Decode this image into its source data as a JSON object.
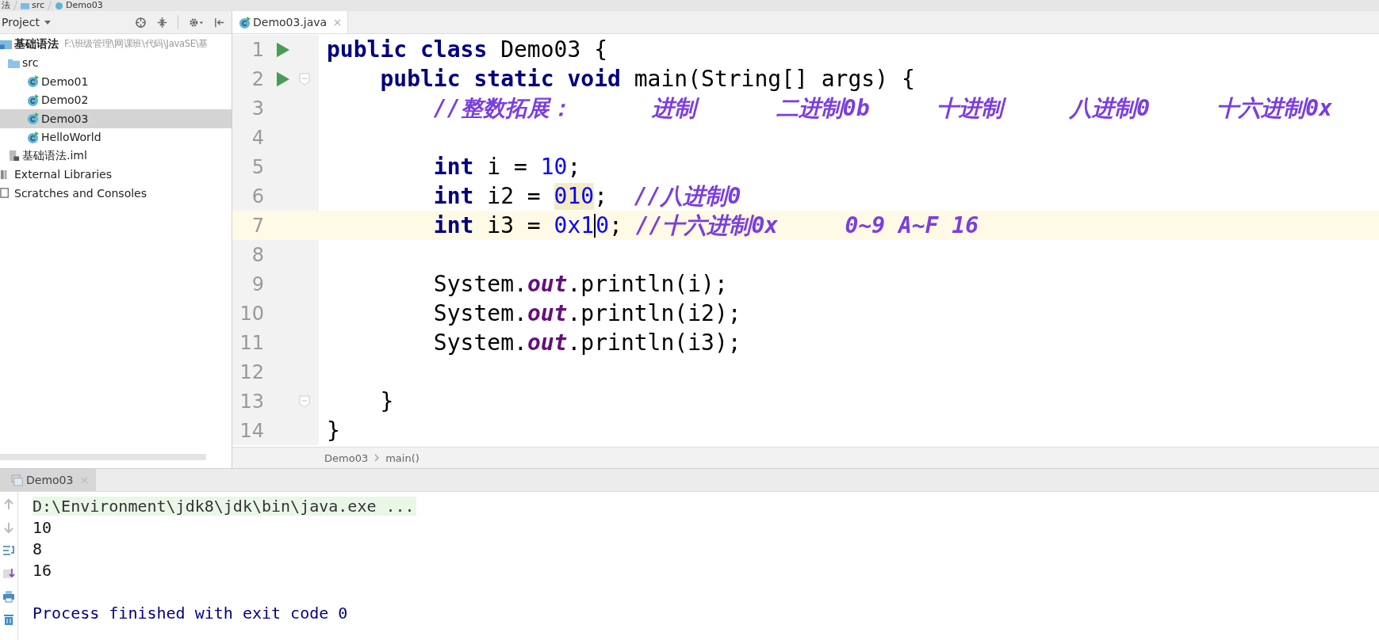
{
  "nav_bar": [
    {
      "label": "法",
      "kind": "module"
    },
    {
      "label": "src",
      "kind": "folder"
    },
    {
      "label": "Demo03",
      "kind": "class"
    }
  ],
  "project_panel": {
    "title": "Project",
    "tree": [
      {
        "label": "基础语法",
        "path": "F:\\班级管理\\网课班\\代码\\JavaSE\\基",
        "kind": "module",
        "selected": false,
        "children": [
          {
            "label": "src",
            "kind": "folder",
            "selected": false,
            "children": [
              {
                "label": "Demo01",
                "kind": "class",
                "selected": false
              },
              {
                "label": "Demo02",
                "kind": "class",
                "selected": false
              },
              {
                "label": "Demo03",
                "kind": "class",
                "selected": true
              },
              {
                "label": "HelloWorld",
                "kind": "class",
                "selected": false
              }
            ]
          },
          {
            "label": "基础语法.iml",
            "kind": "file",
            "selected": false
          }
        ]
      },
      {
        "label": "External Libraries",
        "kind": "library",
        "selected": false
      },
      {
        "label": "Scratches and Consoles",
        "kind": "scratches",
        "selected": false
      }
    ]
  },
  "editor": {
    "tabs": [
      {
        "label": "Demo03.java",
        "selected": true
      }
    ],
    "lines": [
      {
        "number": "1",
        "run": true,
        "tokens": [
          {
            "kind": "keyword",
            "text": "public class"
          },
          {
            "kind": "plain",
            "text": " Demo03 {"
          }
        ]
      },
      {
        "number": "2",
        "run": true,
        "fold": true,
        "tokens": [
          {
            "kind": "keyword",
            "text": "    public static void"
          },
          {
            "kind": "plain",
            "text": " main(String[] args) {"
          }
        ]
      },
      {
        "number": "3",
        "tokens": [
          {
            "kind": "comment",
            "text": "        //整数拓展：      进制      二进制0b     十进制     八进制0     十六进制0x"
          }
        ]
      },
      {
        "number": "4"
      },
      {
        "number": "5",
        "tokens": [
          {
            "kind": "keyword",
            "text": "        int"
          },
          {
            "kind": "plain",
            "text": " i = "
          },
          {
            "kind": "number",
            "text": "10"
          },
          {
            "kind": "plain",
            "text": ";"
          }
        ]
      },
      {
        "number": "6",
        "tokens": [
          {
            "kind": "keyword",
            "text": "        int"
          },
          {
            "kind": "plain",
            "text": " i2 = "
          },
          {
            "kind": "match",
            "text": "010"
          },
          {
            "kind": "plain",
            "text": ";  "
          },
          {
            "kind": "comment",
            "text": "//八进制0"
          }
        ]
      },
      {
        "number": "7",
        "current": true,
        "tokens": [
          {
            "kind": "keyword",
            "text": "        int"
          },
          {
            "kind": "plain",
            "text": " i3 = "
          },
          {
            "kind": "number",
            "text": "0x1"
          },
          {
            "kind": "caret"
          },
          {
            "kind": "number",
            "text": "0"
          },
          {
            "kind": "plain",
            "text": "; "
          },
          {
            "kind": "comment",
            "text": "//十六进制0x     0~9 A~F 16"
          }
        ]
      },
      {
        "number": "8"
      },
      {
        "number": "9",
        "tokens": [
          {
            "kind": "plain",
            "text": "        System."
          },
          {
            "kind": "field",
            "text": "out"
          },
          {
            "kind": "plain",
            "text": ".println(i);"
          }
        ]
      },
      {
        "number": "10",
        "tokens": [
          {
            "kind": "plain",
            "text": "        System."
          },
          {
            "kind": "field",
            "text": "out"
          },
          {
            "kind": "plain",
            "text": ".println(i2);"
          }
        ]
      },
      {
        "number": "11",
        "tokens": [
          {
            "kind": "plain",
            "text": "        System."
          },
          {
            "kind": "field",
            "text": "out"
          },
          {
            "kind": "plain",
            "text": ".println(i3);"
          }
        ]
      },
      {
        "number": "12"
      },
      {
        "number": "13",
        "fold": true,
        "tokens": [
          {
            "kind": "plain",
            "text": "    }"
          }
        ]
      },
      {
        "number": "14",
        "tokens": [
          {
            "kind": "plain",
            "text": "}"
          }
        ]
      }
    ],
    "breadcrumb": [
      "Demo03",
      "main()"
    ]
  },
  "run_panel": {
    "tabs": [
      {
        "label": "Demo03",
        "selected": true
      }
    ],
    "output": [
      {
        "kind": "command",
        "text": "D:\\Environment\\jdk8\\jdk\\bin\\java.exe ..."
      },
      {
        "kind": "stdout",
        "text": "10"
      },
      {
        "kind": "stdout",
        "text": "8"
      },
      {
        "kind": "stdout",
        "text": "16"
      },
      {
        "kind": "blank"
      },
      {
        "kind": "exit",
        "text": "Process finished with exit code 0"
      }
    ]
  }
}
